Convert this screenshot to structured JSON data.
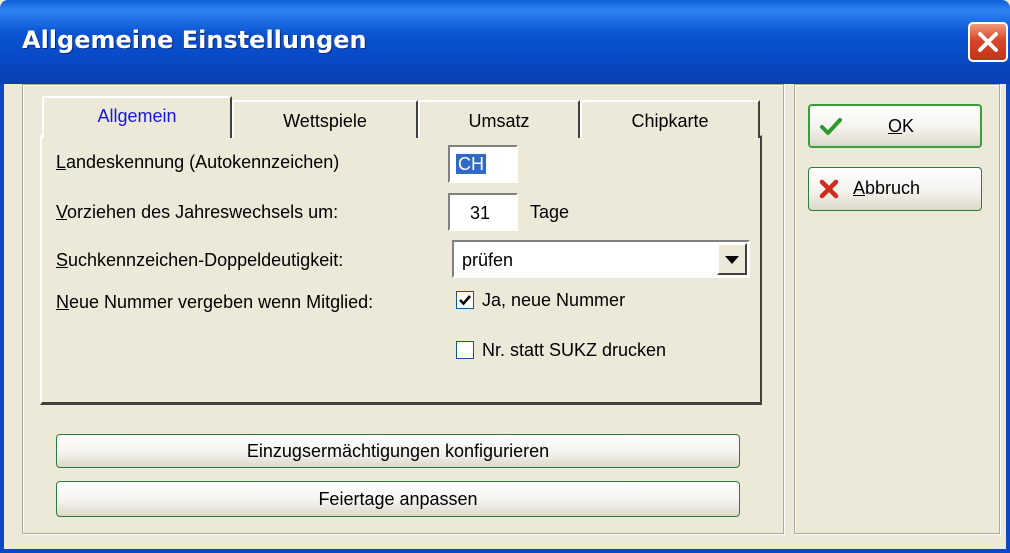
{
  "window": {
    "title": "Allgemeine Einstellungen"
  },
  "tabs": [
    {
      "label": "Allgemein",
      "active": true
    },
    {
      "label": "Wettspiele",
      "active": false
    },
    {
      "label": "Umsatz",
      "active": false
    },
    {
      "label": "Chipkarte",
      "active": false
    }
  ],
  "form": {
    "landes": {
      "mnemonic": "L",
      "rest": "andeskennung (Autokennzeichen)",
      "value": "CH"
    },
    "vorziehen": {
      "mnemonic": "V",
      "rest": "orziehen des Jahreswechsels um:",
      "value": "31",
      "unit": "Tage"
    },
    "such": {
      "mnemonic": "S",
      "rest": "uchkennzeichen-Doppeldeutigkeit:",
      "value": "prüfen"
    },
    "neue": {
      "mnemonic": "N",
      "rest": "eue Nummer vergeben wenn Mitglied:"
    },
    "check_neue": {
      "label": "Ja, neue Nummer",
      "checked": true
    },
    "check_nr": {
      "label": "Nr. statt SUKZ drucken",
      "checked": false
    }
  },
  "buttons": {
    "einzug": "Einzugsermächtigungen konfigurieren",
    "feiertage": "Feiertage anpassen",
    "ok": {
      "mnemonic": "O",
      "rest": "K"
    },
    "abbruch": {
      "mnemonic": "A",
      "rest": "bbruch"
    }
  },
  "colors": {
    "titlebar": "#0a54d2",
    "face": "#ece9d8",
    "active_tab_text": "#1616e0",
    "selection": "#316ac5",
    "ok_check": "#2e9a2e",
    "cancel_x": "#d12a1e"
  },
  "icons": [
    "close-icon",
    "checkmark-icon",
    "cross-icon",
    "dropdown-arrow-icon"
  ]
}
